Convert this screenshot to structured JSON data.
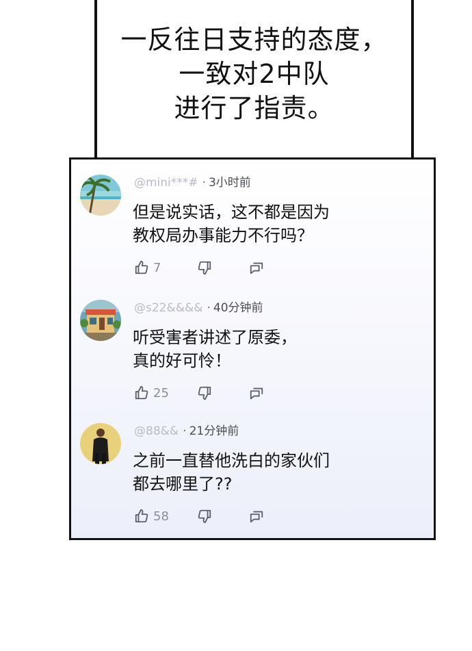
{
  "caption": {
    "lines": [
      "一反往日支持的态度，",
      "一致对2中队",
      "进行了指责。"
    ]
  },
  "comments": [
    {
      "user": "@mini***#",
      "separator": "·",
      "time": "3小时前",
      "lines": [
        "但是说实话，这不都是因为",
        "教权局办事能力不行吗？"
      ],
      "likes": "7",
      "avatar_icon": "beach-avatar"
    },
    {
      "user": "@s22&&&&",
      "separator": "·",
      "time": "40分钟前",
      "lines": [
        "听受害者讲述了原委，",
        "真的好可怜！"
      ],
      "likes": "25",
      "avatar_icon": "storefront-avatar"
    },
    {
      "user": "@88&&",
      "separator": "·",
      "time": "21分钟前",
      "lines": [
        "之前一直替他洗白的家伙们",
        "都去哪里了??"
      ],
      "likes": "58",
      "avatar_icon": "person-avatar"
    }
  ],
  "icons": {
    "like": "thumbs-up-icon",
    "dislike": "thumbs-down-icon",
    "reply": "reply-icon"
  },
  "colors": {
    "border": "#111111",
    "username": "#b8bcc7",
    "time": "#4a4d55",
    "icon": "#5b5f6a"
  }
}
